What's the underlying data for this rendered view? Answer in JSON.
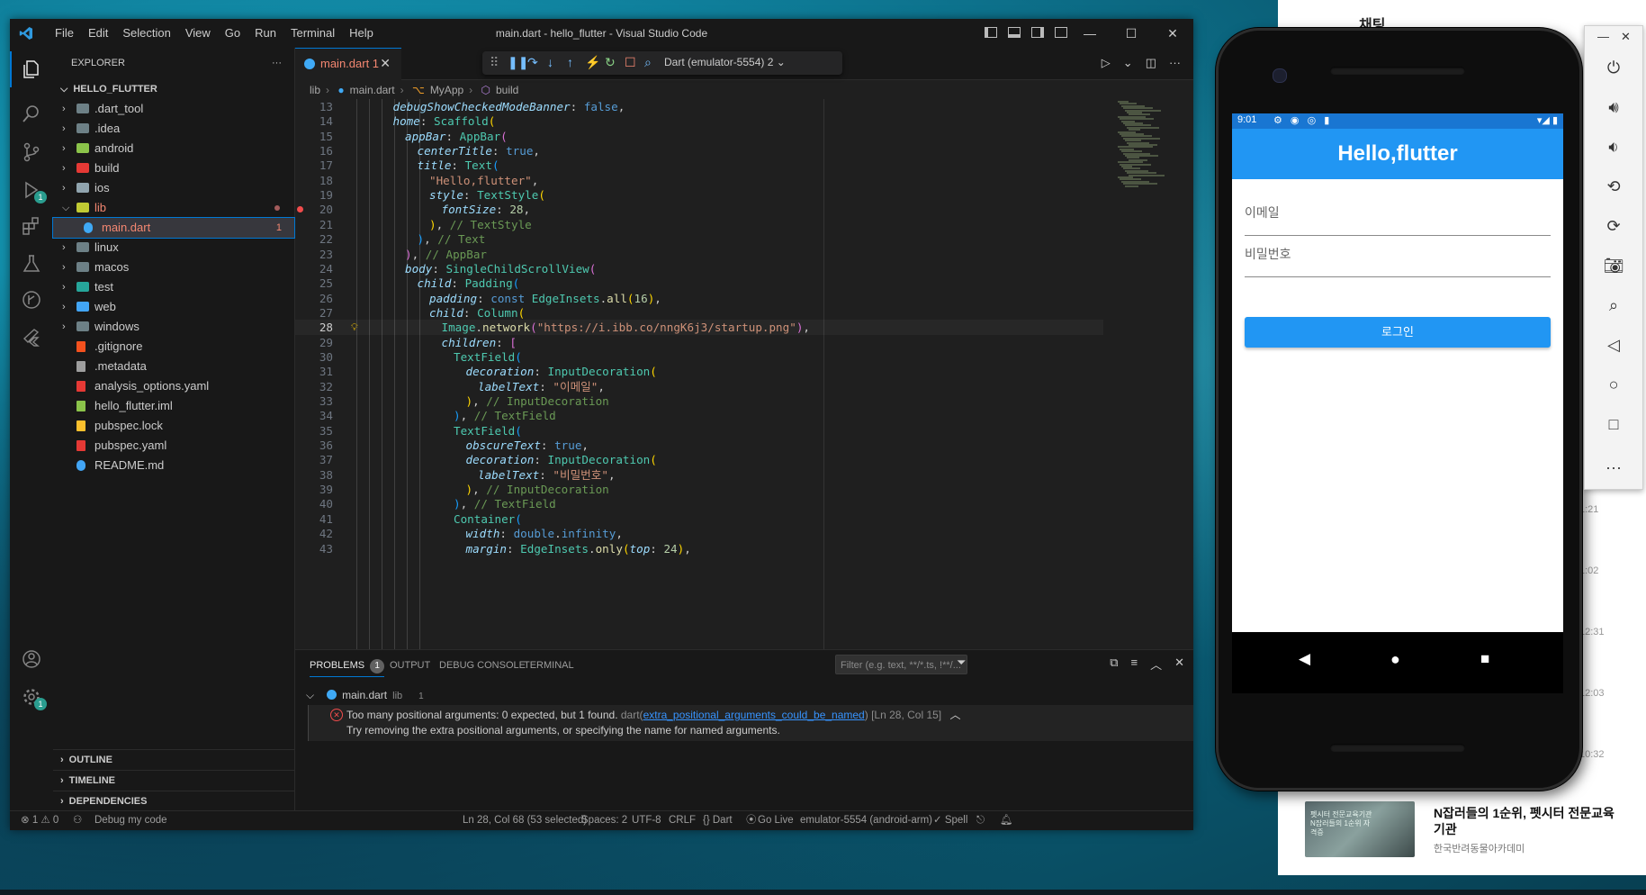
{
  "vscode": {
    "window_title": "main.dart - hello_flutter - Visual Studio Code",
    "menu": [
      "File",
      "Edit",
      "Selection",
      "View",
      "Go",
      "Run",
      "Terminal",
      "Help"
    ],
    "explorer": {
      "title": "EXPLORER",
      "root": "HELLO_FLUTTER",
      "items": [
        {
          "name": ".dart_tool",
          "type": "folder",
          "color": "#6d8086"
        },
        {
          "name": ".idea",
          "type": "folder",
          "color": "#6d8086"
        },
        {
          "name": "android",
          "type": "folder",
          "color": "#8bc34a"
        },
        {
          "name": "build",
          "type": "folder",
          "color": "#e53935"
        },
        {
          "name": "ios",
          "type": "folder",
          "color": "#90a4ae"
        },
        {
          "name": "lib",
          "type": "folder-open",
          "color": "#c0ca33"
        },
        {
          "name": "main.dart",
          "type": "file",
          "color": "#3fa9f5",
          "badge": "1"
        },
        {
          "name": "linux",
          "type": "folder",
          "color": "#6d8086"
        },
        {
          "name": "macos",
          "type": "folder",
          "color": "#6d8086"
        },
        {
          "name": "test",
          "type": "folder",
          "color": "#26a69a"
        },
        {
          "name": "web",
          "type": "folder",
          "color": "#42a5f5"
        },
        {
          "name": "windows",
          "type": "folder",
          "color": "#6d8086"
        },
        {
          "name": ".gitignore",
          "type": "file",
          "color": "#f4511e"
        },
        {
          "name": ".metadata",
          "type": "file",
          "color": "#9e9e9e"
        },
        {
          "name": "analysis_options.yaml",
          "type": "file",
          "color": "#e53935"
        },
        {
          "name": "hello_flutter.iml",
          "type": "file",
          "color": "#8bc34a"
        },
        {
          "name": "pubspec.lock",
          "type": "file",
          "color": "#fbc02d"
        },
        {
          "name": "pubspec.yaml",
          "type": "file",
          "color": "#e53935"
        },
        {
          "name": "README.md",
          "type": "file",
          "color": "#42a5f5"
        }
      ],
      "sections": [
        "OUTLINE",
        "TIMELINE",
        "DEPENDENCIES"
      ]
    },
    "tab": {
      "label": "main.dart 1",
      "close": "✕"
    },
    "debug_target": "Dart (emulator-5554) 2",
    "breadcrumbs": [
      "lib",
      "main.dart",
      "MyApp",
      "build"
    ],
    "code_lines": [
      {
        "n": "13",
        "i": 3,
        "t": [
          [
            "k-prop",
            "debugShowCheckedModeBanner"
          ],
          [
            "k-plain",
            ": "
          ],
          [
            "k-kw",
            "false"
          ],
          [
            "k-plain",
            ","
          ]
        ]
      },
      {
        "n": "14",
        "i": 3,
        "t": [
          [
            "k-prop",
            "home"
          ],
          [
            "k-plain",
            ": "
          ],
          [
            "k-cls",
            "Scaffold"
          ],
          [
            "k-p1",
            "("
          ]
        ]
      },
      {
        "n": "15",
        "i": 4,
        "t": [
          [
            "k-prop",
            "appBar"
          ],
          [
            "k-plain",
            ": "
          ],
          [
            "k-cls",
            "AppBar"
          ],
          [
            "k-p2",
            "("
          ]
        ]
      },
      {
        "n": "16",
        "i": 5,
        "t": [
          [
            "k-prop",
            "centerTitle"
          ],
          [
            "k-plain",
            ": "
          ],
          [
            "k-kw",
            "true"
          ],
          [
            "k-plain",
            ","
          ]
        ]
      },
      {
        "n": "17",
        "i": 5,
        "t": [
          [
            "k-prop",
            "title"
          ],
          [
            "k-plain",
            ": "
          ],
          [
            "k-cls",
            "Text"
          ],
          [
            "k-p3",
            "("
          ]
        ]
      },
      {
        "n": "18",
        "i": 6,
        "t": [
          [
            "k-str",
            "\"Hello,flutter\""
          ],
          [
            "k-plain",
            ","
          ]
        ]
      },
      {
        "n": "19",
        "i": 6,
        "t": [
          [
            "k-prop",
            "style"
          ],
          [
            "k-plain",
            ": "
          ],
          [
            "k-cls",
            "TextStyle"
          ],
          [
            "k-p1",
            "("
          ]
        ]
      },
      {
        "n": "20",
        "i": 7,
        "t": [
          [
            "k-prop",
            "fontSize"
          ],
          [
            "k-plain",
            ": "
          ],
          [
            "k-num",
            "28"
          ],
          [
            "k-plain",
            ","
          ]
        ],
        "err": true
      },
      {
        "n": "21",
        "i": 6,
        "t": [
          [
            "k-p1",
            ")"
          ],
          [
            "k-plain",
            ", "
          ],
          [
            "k-cmt",
            "// TextStyle"
          ]
        ]
      },
      {
        "n": "22",
        "i": 5,
        "t": [
          [
            "k-p3",
            ")"
          ],
          [
            "k-plain",
            ", "
          ],
          [
            "k-cmt",
            "// Text"
          ]
        ]
      },
      {
        "n": "23",
        "i": 4,
        "t": [
          [
            "k-p2",
            ")"
          ],
          [
            "k-plain",
            ", "
          ],
          [
            "k-cmt",
            "// AppBar"
          ]
        ]
      },
      {
        "n": "24",
        "i": 4,
        "t": [
          [
            "k-prop",
            "body"
          ],
          [
            "k-plain",
            ": "
          ],
          [
            "k-cls",
            "SingleChildScrollView"
          ],
          [
            "k-p2",
            "("
          ]
        ]
      },
      {
        "n": "25",
        "i": 5,
        "t": [
          [
            "k-prop",
            "child"
          ],
          [
            "k-plain",
            ": "
          ],
          [
            "k-cls",
            "Padding"
          ],
          [
            "k-p3",
            "("
          ]
        ]
      },
      {
        "n": "26",
        "i": 6,
        "t": [
          [
            "k-prop",
            "padding"
          ],
          [
            "k-plain",
            ": "
          ],
          [
            "k-kw",
            "const "
          ],
          [
            "k-cls",
            "EdgeInsets"
          ],
          [
            "k-plain",
            "."
          ],
          [
            "k-fn",
            "all"
          ],
          [
            "k-p1",
            "("
          ],
          [
            "k-num",
            "16"
          ],
          [
            "k-p1",
            ")"
          ],
          [
            "k-plain",
            ","
          ]
        ]
      },
      {
        "n": "27",
        "i": 6,
        "t": [
          [
            "k-prop",
            "child"
          ],
          [
            "k-plain",
            ": "
          ],
          [
            "k-cls",
            "Column"
          ],
          [
            "k-p1",
            "("
          ]
        ]
      },
      {
        "n": "28",
        "i": 7,
        "t": [
          [
            "k-cls",
            "Image"
          ],
          [
            "k-plain",
            "."
          ],
          [
            "k-fn",
            "network"
          ],
          [
            "k-p2",
            "("
          ],
          [
            "k-str",
            "\"https://i.ibb.co/nngK6j3/startup.png\""
          ],
          [
            "k-p2",
            ")"
          ],
          [
            "k-plain",
            ","
          ]
        ],
        "cur": true
      },
      {
        "n": "29",
        "i": 7,
        "t": [
          [
            "k-prop",
            "children"
          ],
          [
            "k-plain",
            ": "
          ],
          [
            "k-p2",
            "["
          ]
        ]
      },
      {
        "n": "30",
        "i": 8,
        "t": [
          [
            "k-cls",
            "TextField"
          ],
          [
            "k-p3",
            "("
          ]
        ]
      },
      {
        "n": "31",
        "i": 9,
        "t": [
          [
            "k-prop",
            "decoration"
          ],
          [
            "k-plain",
            ": "
          ],
          [
            "k-cls",
            "InputDecoration"
          ],
          [
            "k-p1",
            "("
          ]
        ]
      },
      {
        "n": "32",
        "i": 10,
        "t": [
          [
            "k-prop",
            "labelText"
          ],
          [
            "k-plain",
            ": "
          ],
          [
            "k-str",
            "\"이메일\""
          ],
          [
            "k-plain",
            ","
          ]
        ]
      },
      {
        "n": "33",
        "i": 9,
        "t": [
          [
            "k-p1",
            ")"
          ],
          [
            "k-plain",
            ", "
          ],
          [
            "k-cmt",
            "// InputDecoration"
          ]
        ]
      },
      {
        "n": "34",
        "i": 8,
        "t": [
          [
            "k-p3",
            ")"
          ],
          [
            "k-plain",
            ", "
          ],
          [
            "k-cmt",
            "// TextField"
          ]
        ]
      },
      {
        "n": "35",
        "i": 8,
        "t": [
          [
            "k-cls",
            "TextField"
          ],
          [
            "k-p3",
            "("
          ]
        ]
      },
      {
        "n": "36",
        "i": 9,
        "t": [
          [
            "k-prop",
            "obscureText"
          ],
          [
            "k-plain",
            ": "
          ],
          [
            "k-kw",
            "true"
          ],
          [
            "k-plain",
            ","
          ]
        ]
      },
      {
        "n": "37",
        "i": 9,
        "t": [
          [
            "k-prop",
            "decoration"
          ],
          [
            "k-plain",
            ": "
          ],
          [
            "k-cls",
            "InputDecoration"
          ],
          [
            "k-p1",
            "("
          ]
        ]
      },
      {
        "n": "38",
        "i": 10,
        "t": [
          [
            "k-prop",
            "labelText"
          ],
          [
            "k-plain",
            ": "
          ],
          [
            "k-str",
            "\"비밀번호\""
          ],
          [
            "k-plain",
            ","
          ]
        ]
      },
      {
        "n": "39",
        "i": 9,
        "t": [
          [
            "k-p1",
            ")"
          ],
          [
            "k-plain",
            ", "
          ],
          [
            "k-cmt",
            "// InputDecoration"
          ]
        ]
      },
      {
        "n": "40",
        "i": 8,
        "t": [
          [
            "k-p3",
            ")"
          ],
          [
            "k-plain",
            ", "
          ],
          [
            "k-cmt",
            "// TextField"
          ]
        ]
      },
      {
        "n": "41",
        "i": 8,
        "t": [
          [
            "k-cls",
            "Container"
          ],
          [
            "k-p3",
            "("
          ]
        ]
      },
      {
        "n": "42",
        "i": 9,
        "t": [
          [
            "k-prop",
            "width"
          ],
          [
            "k-plain",
            ": "
          ],
          [
            "k-kw",
            "double"
          ],
          [
            "k-plain",
            "."
          ],
          [
            "k-kw",
            "infinity"
          ],
          [
            "k-plain",
            ","
          ]
        ]
      },
      {
        "n": "43",
        "i": 9,
        "t": [
          [
            "k-prop",
            "margin"
          ],
          [
            "k-plain",
            ": "
          ],
          [
            "k-cls",
            "EdgeInsets"
          ],
          [
            "k-plain",
            "."
          ],
          [
            "k-fn",
            "only"
          ],
          [
            "k-p1",
            "("
          ],
          [
            "k-prop",
            "top"
          ],
          [
            "k-plain",
            ": "
          ],
          [
            "k-num",
            "24"
          ],
          [
            "k-p1",
            ")"
          ],
          [
            "k-plain",
            ","
          ]
        ]
      }
    ],
    "panel": {
      "tabs": [
        "PROBLEMS",
        "OUTPUT",
        "DEBUG CONSOLE",
        "TERMINAL"
      ],
      "problems_count": "1",
      "filter_placeholder": "Filter (e.g. text, **/*.ts, !**/...",
      "file": "main.dart",
      "file_dir": "lib",
      "file_count": "1",
      "error_message": "Too many positional arguments: 0 expected, but 1 found.",
      "error_source": "dart(",
      "error_code": "extra_positional_arguments_could_be_named",
      "error_source_end": ")",
      "error_location": "[Ln 28, Col 15]",
      "error_hint": "Try removing the extra positional arguments, or specifying the name for named arguments."
    },
    "status": {
      "problems": "⊗ 1 ⚠ 0",
      "debug": "Debug my code",
      "cursor": "Ln 28, Col 68 (53 selected)",
      "spaces": "Spaces: 2",
      "encoding": "UTF-8",
      "eol": "CRLF",
      "language": "{} Dart",
      "golive": "Go Live",
      "device": "emulator-5554 (android-arm)",
      "spell": "✓ Spell"
    }
  },
  "emulator": {
    "status_time": "9:01",
    "app_title": "Hello,flutter",
    "email_label": "이메일",
    "password_label": "비밀번호",
    "login_button": "로그인"
  },
  "background_window": {
    "title": "채팅",
    "times": [
      "1:21",
      "1:02",
      "12:31",
      "12:03",
      "10:32"
    ],
    "ad_title": "N잡러들의 1순위, 펫시터 전문교육기관",
    "ad_sub": "한국반려동물아카데미",
    "ad_image_text": "펫시터 전문교육기관 N잡러들의 1순위 자격증"
  }
}
